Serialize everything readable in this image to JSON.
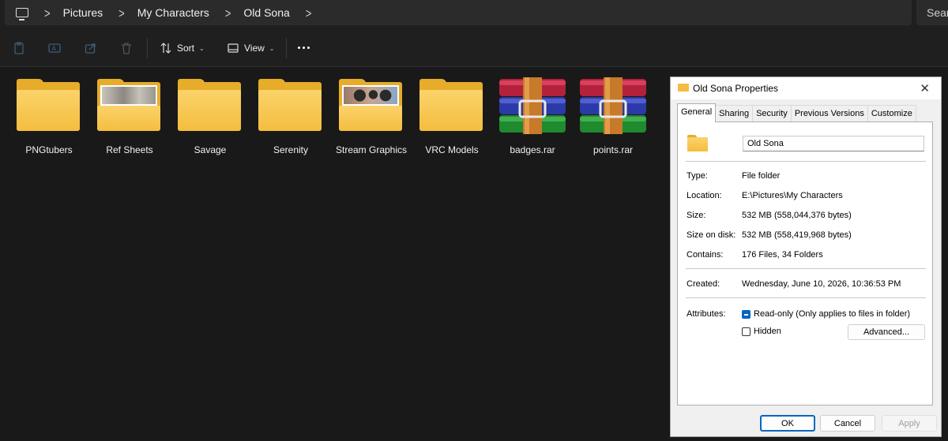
{
  "address": {
    "crumbs": [
      "Pictures",
      "My Characters",
      "Old Sona"
    ],
    "search_placeholder": "Search"
  },
  "toolbar": {
    "sort_label": "Sort",
    "view_label": "View"
  },
  "items": [
    {
      "name": "PNGtubers",
      "kind": "folder"
    },
    {
      "name": "Ref Sheets",
      "kind": "folder-with-image"
    },
    {
      "name": "Savage",
      "kind": "folder"
    },
    {
      "name": "Serenity",
      "kind": "folder"
    },
    {
      "name": "Stream Graphics",
      "kind": "folder-with-image"
    },
    {
      "name": "VRC Models",
      "kind": "folder"
    },
    {
      "name": "badges.rar",
      "kind": "rar-archive"
    },
    {
      "name": "points.rar",
      "kind": "rar-archive"
    }
  ],
  "dialog": {
    "title": "Old Sona Properties",
    "tabs": [
      "General",
      "Sharing",
      "Security",
      "Previous Versions",
      "Customize"
    ],
    "active_tab": "General",
    "folder_name": "Old Sona",
    "type_label": "Type:",
    "type_value": "File folder",
    "location_label": "Location:",
    "location_value": "E:\\Pictures\\My Characters",
    "size_label": "Size:",
    "size_value": "532 MB (558,044,376 bytes)",
    "size_on_disk_label": "Size on disk:",
    "size_on_disk_value": "532 MB (558,419,968 bytes)",
    "contains_label": "Contains:",
    "contains_value": "176 Files, 34 Folders",
    "created_label": "Created:",
    "created_value": "Wednesday, June 10, 2026, 10:36:53 PM",
    "attributes_label": "Attributes:",
    "readonly_label": "Read-only (Only applies to files in folder)",
    "readonly_state": "indeterminate",
    "hidden_label": "Hidden",
    "hidden_state": "unchecked",
    "advanced_label": "Advanced...",
    "ok_label": "OK",
    "cancel_label": "Cancel",
    "apply_label": "Apply"
  },
  "colors": {
    "background": "#191919",
    "folder": "#f4bd3f",
    "accent": "#0067c0"
  }
}
